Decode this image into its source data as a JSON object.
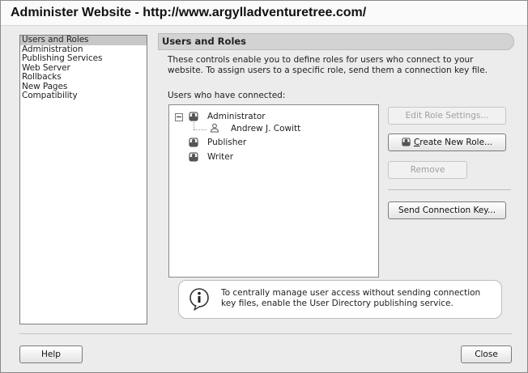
{
  "window": {
    "title": "Administer Website - http://www.argylladventuretree.com/"
  },
  "sidebar": {
    "items": [
      {
        "label": "Users and Roles",
        "selected": true
      },
      {
        "label": "Administration",
        "selected": false
      },
      {
        "label": "Publishing Services",
        "selected": false
      },
      {
        "label": "Web Server",
        "selected": false
      },
      {
        "label": "Rollbacks",
        "selected": false
      },
      {
        "label": "New Pages",
        "selected": false
      },
      {
        "label": "Compatibility",
        "selected": false
      }
    ]
  },
  "main": {
    "section_title": "Users and Roles",
    "description": "These controls enable you to define roles for users who connect to your website. To assign users to a specific role, send them a connection key file.",
    "users_label": "Users who have connected:",
    "tree": [
      {
        "label": "Administrator",
        "type": "role",
        "expanded": true,
        "icon": "role-icon"
      },
      {
        "label": "Andrew J. Cowitt",
        "type": "user",
        "icon": "person-icon"
      },
      {
        "label": "Publisher",
        "type": "role",
        "icon": "role-icon"
      },
      {
        "label": "Writer",
        "type": "role",
        "icon": "role-icon"
      }
    ],
    "buttons": {
      "edit_role": {
        "label": "Edit Role Settings...",
        "enabled": false
      },
      "create_role": {
        "label": "Create New Role...",
        "enabled": true,
        "icon": "role-icon"
      },
      "remove": {
        "label": "Remove",
        "enabled": false
      },
      "send_key": {
        "label": "Send Connection Key...",
        "enabled": true
      }
    },
    "info": {
      "icon": "info-icon",
      "text": "To centrally manage user access without sending connection key files, enable the User Directory publishing service."
    }
  },
  "footer": {
    "help_label": "Help",
    "close_label": "Close"
  }
}
